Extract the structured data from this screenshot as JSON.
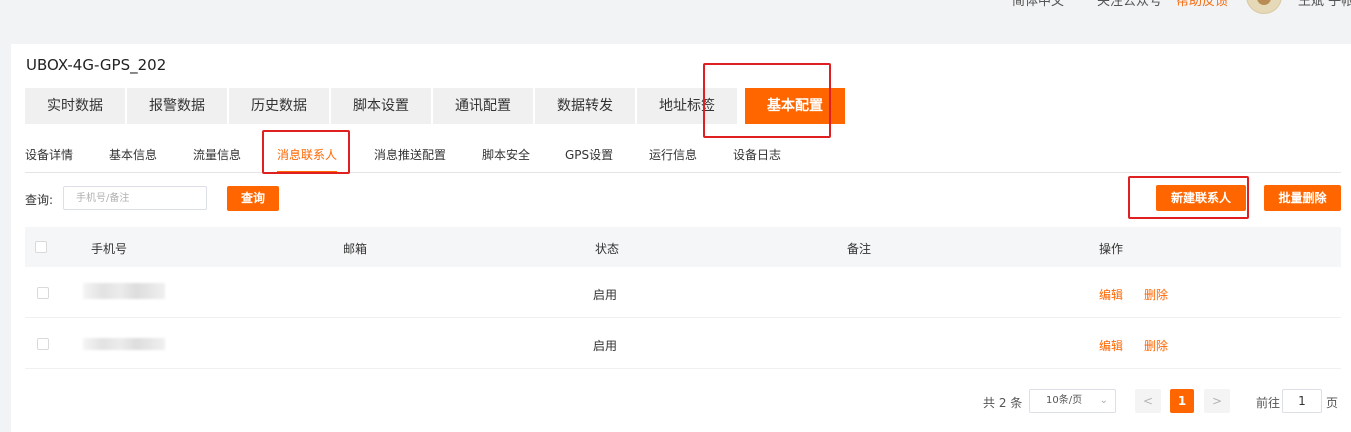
{
  "header": {
    "items": [
      "简体中文",
      "关注公众号",
      "帮助反馈",
      "王斌 子帐"
    ],
    "accent": "#f56c10"
  },
  "device": {
    "title": "UBOX-4G-GPS_202"
  },
  "main_tabs": [
    {
      "label": "实时数据"
    },
    {
      "label": "报警数据"
    },
    {
      "label": "历史数据"
    },
    {
      "label": "脚本设置"
    },
    {
      "label": "通讯配置"
    },
    {
      "label": "数据转发"
    },
    {
      "label": "地址标签"
    },
    {
      "label": "基本配置",
      "active": true
    }
  ],
  "sub_tabs": [
    {
      "label": "设备详情"
    },
    {
      "label": "基本信息"
    },
    {
      "label": "流量信息"
    },
    {
      "label": "消息联系人",
      "active": true
    },
    {
      "label": "消息推送配置"
    },
    {
      "label": "脚本安全"
    },
    {
      "label": "GPS设置"
    },
    {
      "label": "运行信息"
    },
    {
      "label": "设备日志"
    }
  ],
  "query": {
    "label": "查询:",
    "placeholder": "手机号/备注",
    "button": "查询"
  },
  "actions": {
    "new_contact": "新建联系人",
    "batch_delete": "批量删除"
  },
  "table": {
    "columns": [
      "手机号",
      "邮箱",
      "状态",
      "备注",
      "操作"
    ],
    "rows": [
      {
        "phone": "",
        "email": "",
        "status": "启用",
        "note": "",
        "edit": "编辑",
        "delete": "删除"
      },
      {
        "phone": "",
        "email": "",
        "status": "启用",
        "note": "",
        "edit": "编辑",
        "delete": "删除"
      }
    ]
  },
  "pagination": {
    "total": "共 2 条",
    "page_size": "10条/页",
    "prev": "<",
    "current": "1",
    "next": ">",
    "goto_label": "前往",
    "goto_value": "1",
    "goto_unit": "页"
  },
  "colors": {
    "primary": "#ff6600",
    "annotation": "#e02020"
  }
}
